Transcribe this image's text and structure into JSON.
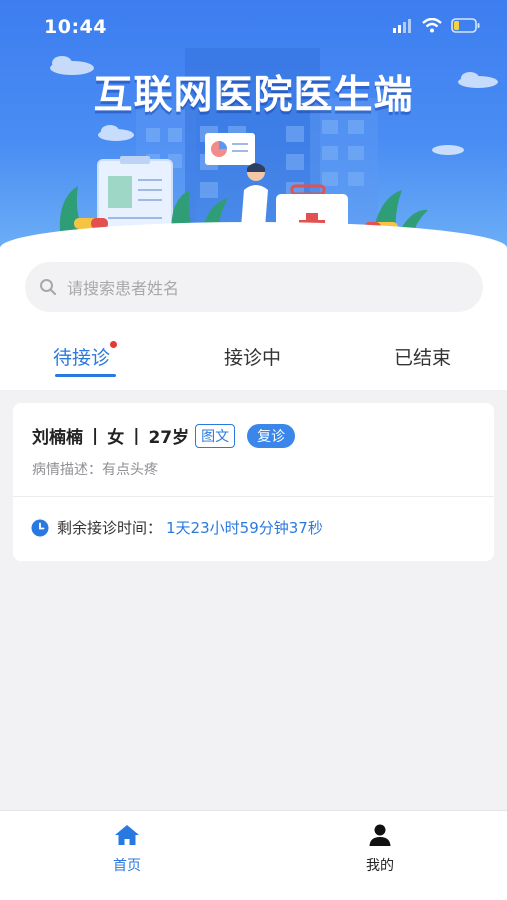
{
  "status_bar": {
    "time": "10:44"
  },
  "header": {
    "title": "互联网医院医生端"
  },
  "search": {
    "placeholder": "请搜索患者姓名"
  },
  "tabs": [
    {
      "label": "待接诊",
      "active": true,
      "has_dot": true
    },
    {
      "label": "接诊中",
      "active": false
    },
    {
      "label": "已结束",
      "active": false
    }
  ],
  "consultation": {
    "name": "刘楠楠",
    "sex": "女",
    "age": "27岁",
    "separator": "|",
    "type_tag": "图文",
    "visit_tag": "复诊",
    "description": "病情描述：有点头疼",
    "remaining_label": "剩余接诊时间：",
    "remaining_value": "1天23小时59分钟37秒"
  },
  "bottom_nav": [
    {
      "label": "首页",
      "icon": "home-icon",
      "active": true
    },
    {
      "label": "我的",
      "icon": "user-icon",
      "active": false
    }
  ],
  "colors": {
    "primary": "#2a79e0",
    "header_top": "#3d7df0",
    "badge_red": "#e53935"
  }
}
